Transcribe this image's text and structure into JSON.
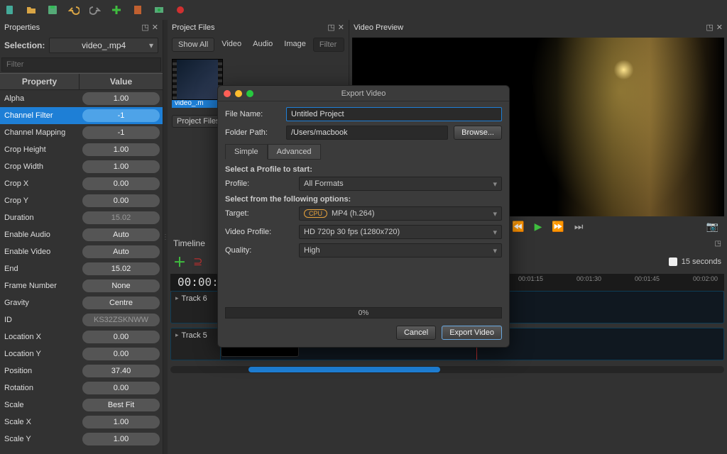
{
  "toolbar": {
    "icons": [
      "file-new",
      "file-open",
      "file-save",
      "undo",
      "redo",
      "add",
      "marker",
      "export",
      "record"
    ]
  },
  "panels": {
    "properties_title": "Properties",
    "project_files_title": "Project Files",
    "video_preview_title": "Video Preview"
  },
  "selection": {
    "label": "Selection:",
    "value": "video_.mp4"
  },
  "prop_filter_placeholder": "Filter",
  "prop_headers": {
    "c1": "Property",
    "c2": "Value"
  },
  "properties": [
    {
      "name": "Alpha",
      "value": "1.00"
    },
    {
      "name": "Channel Filter",
      "value": "-1",
      "selected": true
    },
    {
      "name": "Channel Mapping",
      "value": "-1"
    },
    {
      "name": "Crop Height",
      "value": "1.00"
    },
    {
      "name": "Crop Width",
      "value": "1.00"
    },
    {
      "name": "Crop X",
      "value": "0.00"
    },
    {
      "name": "Crop Y",
      "value": "0.00"
    },
    {
      "name": "Duration",
      "value": "15.02",
      "dim": true
    },
    {
      "name": "Enable Audio",
      "value": "Auto"
    },
    {
      "name": "Enable Video",
      "value": "Auto"
    },
    {
      "name": "End",
      "value": "15.02"
    },
    {
      "name": "Frame Number",
      "value": "None"
    },
    {
      "name": "Gravity",
      "value": "Centre"
    },
    {
      "name": "ID",
      "value": "KS32ZSKNWW",
      "dim": true
    },
    {
      "name": "Location X",
      "value": "0.00"
    },
    {
      "name": "Location Y",
      "value": "0.00"
    },
    {
      "name": "Position",
      "value": "37.40"
    },
    {
      "name": "Rotation",
      "value": "0.00"
    },
    {
      "name": "Scale",
      "value": "Best Fit"
    },
    {
      "name": "Scale X",
      "value": "1.00"
    },
    {
      "name": "Scale Y",
      "value": "1.00"
    }
  ],
  "pf_tabs": {
    "show_all": "Show All",
    "video": "Video",
    "audio": "Audio",
    "image": "Image",
    "filter": "Filter"
  },
  "pf_thumb_label": "video_.m",
  "pf_lower_tab": "Project Files",
  "timeline": {
    "title": "Timeline",
    "zoom_label": "15 seconds",
    "big_time": "00:00:4",
    "ticks": [
      "00:01:15",
      "00:01:30",
      "00:01:45",
      "00:02:00"
    ],
    "tracks": [
      {
        "label": "Track 6"
      },
      {
        "label": "Track 5"
      }
    ]
  },
  "dialog": {
    "title": "Export Video",
    "file_name_label": "File Name:",
    "file_name_value": "Untitled Project",
    "folder_label": "Folder Path:",
    "folder_value": "/Users/macbook",
    "browse": "Browse...",
    "tab_simple": "Simple",
    "tab_advanced": "Advanced",
    "sect1": "Select a Profile to start:",
    "profile_label": "Profile:",
    "profile_value": "All Formats",
    "sect2": "Select from the following options:",
    "target_label": "Target:",
    "target_badge": "CPU",
    "target_value": "MP4 (h.264)",
    "vprofile_label": "Video Profile:",
    "vprofile_value": "HD 720p 30 fps (1280x720)",
    "quality_label": "Quality:",
    "quality_value": "High",
    "progress": "0%",
    "cancel": "Cancel",
    "export": "Export Video"
  }
}
